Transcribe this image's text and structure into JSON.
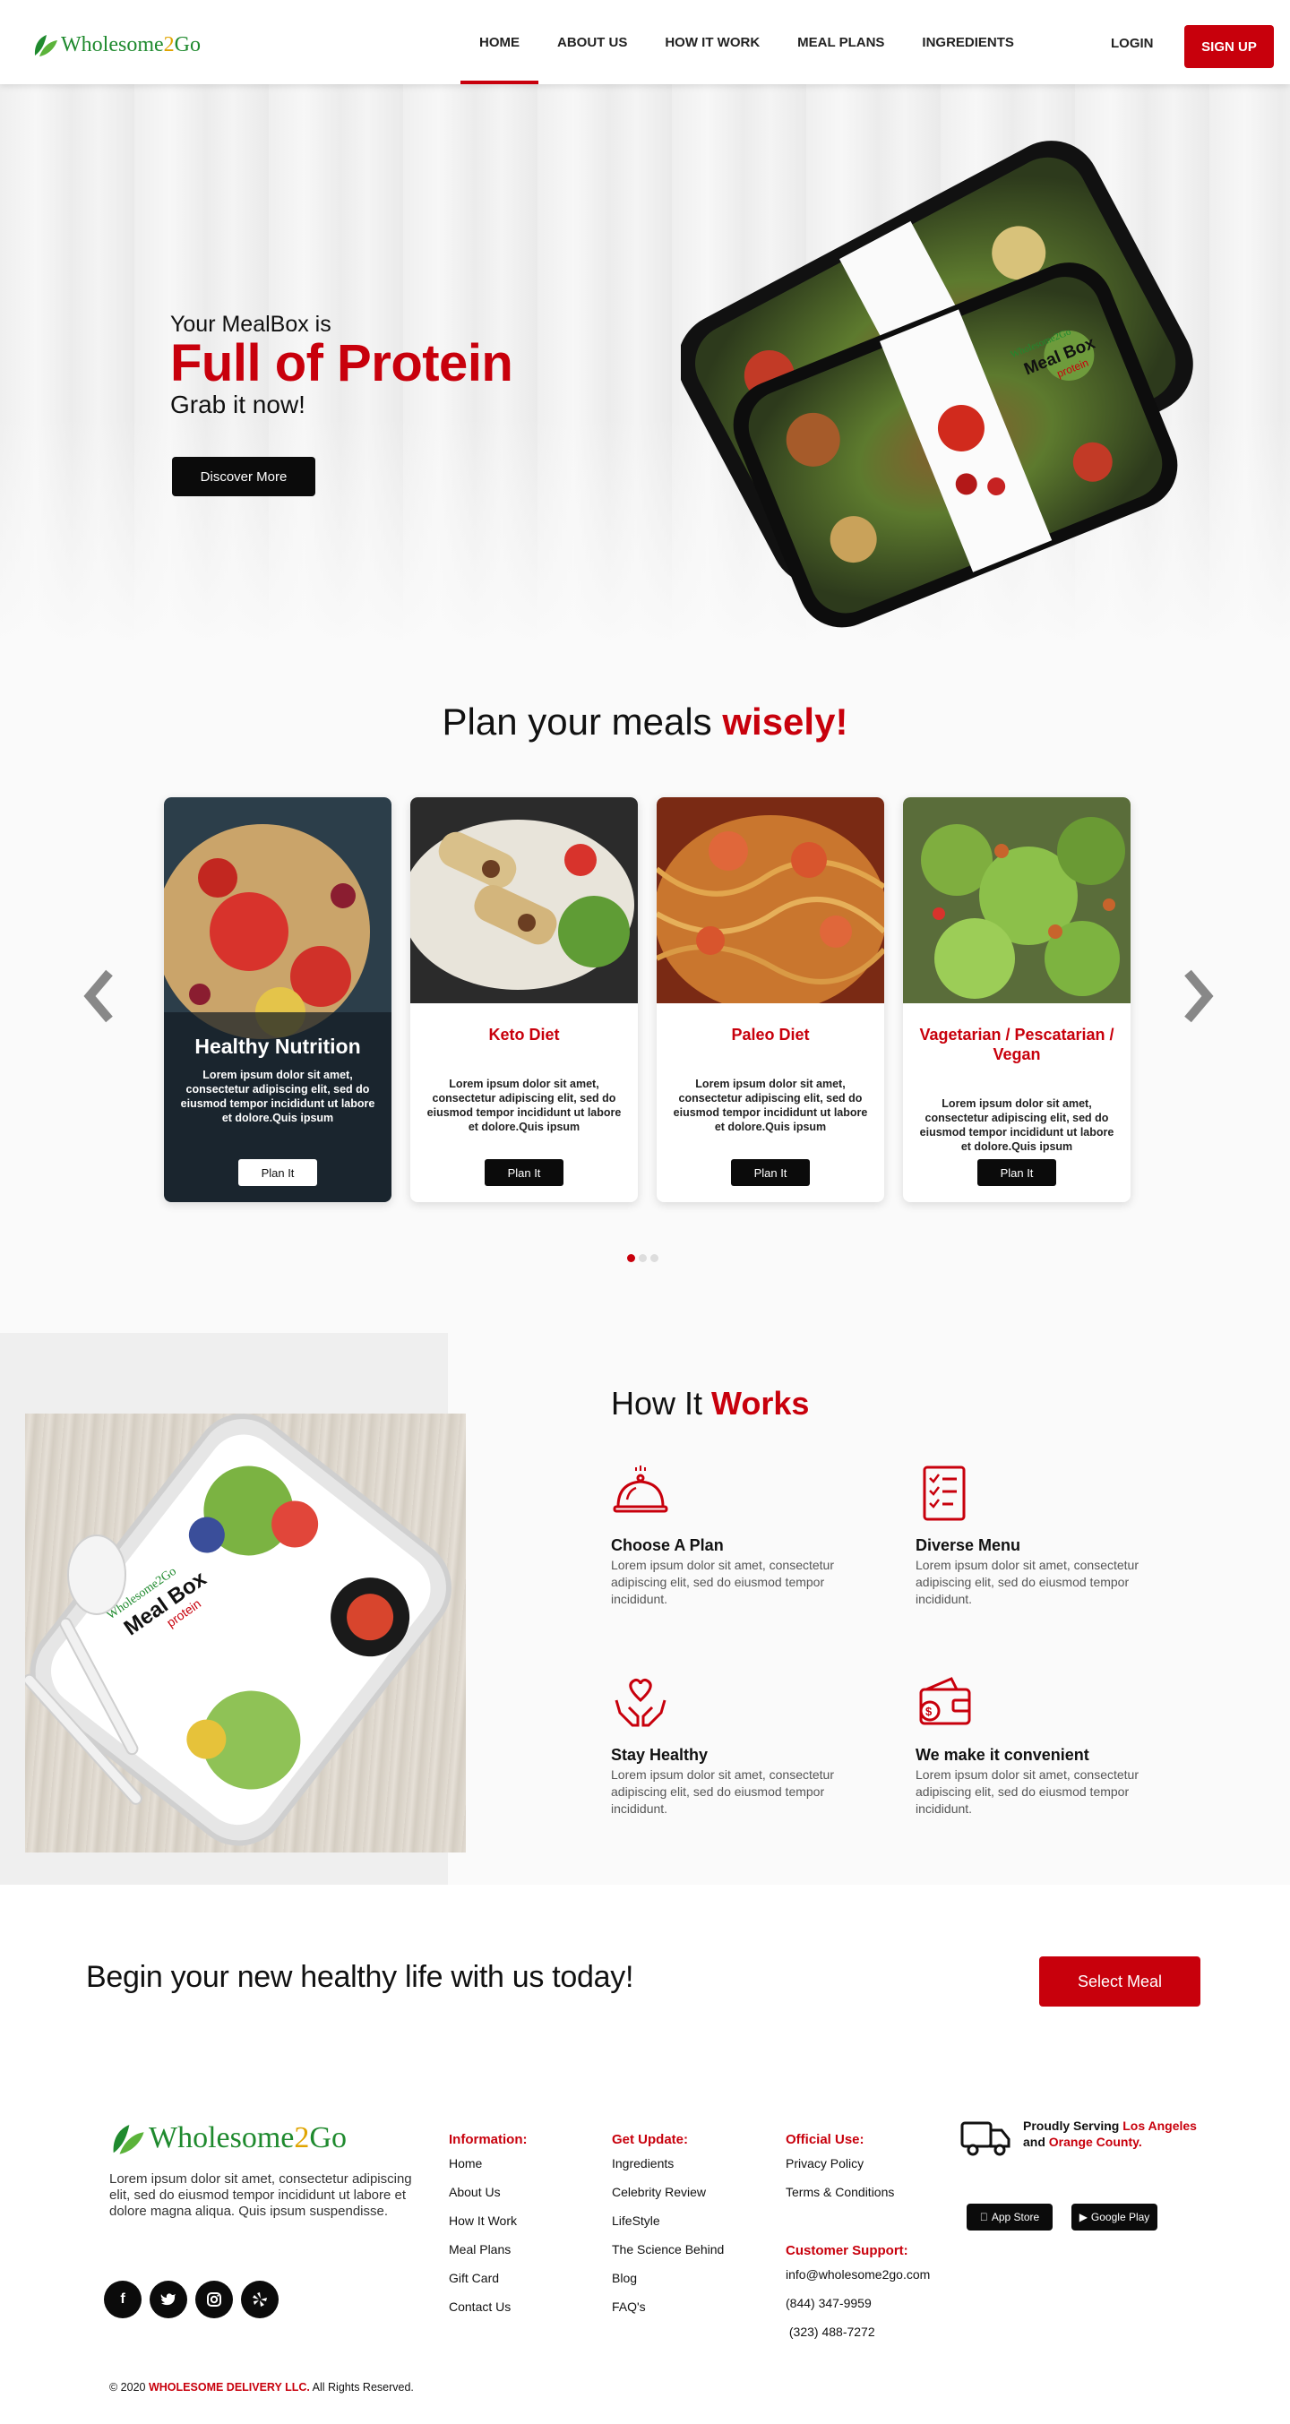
{
  "brand": {
    "name_part1": "Wholesome",
    "name_part2": "2",
    "name_part3": "Go"
  },
  "nav": {
    "links": [
      {
        "label": "HOME",
        "active": true
      },
      {
        "label": "ABOUT US",
        "active": false
      },
      {
        "label": "HOW IT WORK",
        "active": false
      },
      {
        "label": "MEAL PLANS",
        "active": false
      },
      {
        "label": "INGREDIENTS",
        "active": false
      }
    ],
    "login": "LOGIN",
    "signup": "SIGN UP"
  },
  "hero": {
    "subtitle": "Your MealBox is",
    "title": "Full of Protein",
    "tagline": "Grab it now!",
    "button": "Discover More",
    "box_label_brand": "Wholesome2Go",
    "box_label_title": "Meal Box",
    "box_label_sub": "protein"
  },
  "plans": {
    "title_plain": "Plan your meals",
    "title_accent": "wisely!",
    "cards": [
      {
        "title": "Healthy Nutrition",
        "desc": "Lorem ipsum dolor sit amet, consectetur adipiscing elit, sed do eiusmod tempor incididunt ut labore et dolore.Quis ipsum",
        "button": "Plan It"
      },
      {
        "title": "Keto Diet",
        "desc": "Lorem ipsum dolor sit amet, consectetur adipiscing elit, sed do eiusmod tempor incididunt ut labore et dolore.Quis ipsum",
        "button": "Plan It"
      },
      {
        "title": "Paleo Diet",
        "desc": "Lorem ipsum dolor sit amet, consectetur adipiscing elit, sed do eiusmod tempor incididunt ut labore et dolore.Quis ipsum",
        "button": "Plan It"
      },
      {
        "title": "Vagetarian / Pescatarian / Vegan",
        "desc": "Lorem ipsum dolor sit amet, consectetur adipiscing elit, sed do eiusmod tempor incididunt ut labore et dolore.Quis ipsum",
        "button": "Plan It"
      }
    ]
  },
  "how": {
    "title_plain": "How It",
    "title_accent": "Works",
    "features": [
      {
        "icon": "cloche-icon",
        "title": "Choose A Plan",
        "desc": "Lorem ipsum dolor sit amet, consectetur adipiscing elit, sed do eiusmod tempor incididunt."
      },
      {
        "icon": "menu-list-icon",
        "title": "Diverse Menu",
        "desc": "Lorem ipsum dolor sit amet, consectetur adipiscing elit, sed do eiusmod tempor incididunt."
      },
      {
        "icon": "heart-hands-icon",
        "title": "Stay Healthy",
        "desc": "Lorem ipsum dolor sit amet, consectetur adipiscing elit, sed do eiusmod tempor incididunt."
      },
      {
        "icon": "wallet-icon",
        "title": "We make it  convenient",
        "desc": "Lorem ipsum dolor sit amet, consectetur adipiscing elit, sed do eiusmod tempor incididunt."
      }
    ]
  },
  "cta": {
    "text": "Begin your  new healthy life with us today!",
    "button": "Select Meal"
  },
  "footer": {
    "about": "Lorem ipsum dolor sit amet, consectetur adipiscing elit, sed do eiusmod tempor incididunt ut labore et dolore magna aliqua. Quis ipsum suspendisse.",
    "socials": [
      "facebook-icon",
      "twitter-icon",
      "instagram-icon",
      "yelp-icon"
    ],
    "information": {
      "title": "Information:",
      "items": [
        "Home",
        "About Us",
        "How It Work",
        "Meal Plans",
        "Gift Card",
        "Contact Us"
      ]
    },
    "updates": {
      "title": "Get Update:",
      "items": [
        "Ingredients",
        "Celebrity Review",
        "LifeStyle",
        "The Science Behind",
        "Blog",
        "FAQ's"
      ]
    },
    "official": {
      "title": "Official Use:",
      "items": [
        "Privacy Policy",
        "Terms & Conditions"
      ]
    },
    "support": {
      "title": "Customer Support:",
      "items": [
        "info@wholesome2go.com",
        "(844) 347-9959",
        " (323) 488-7272"
      ]
    },
    "serving": {
      "prefix": "Proudly Serving",
      "city1": "Los Angeles",
      "and": "and",
      "city2": "Orange County."
    },
    "appstore": "App Store",
    "googleplay": "Google Play",
    "copyright": {
      "prefix": "© 2020",
      "company": "WHOLESOME DELIVERY LLC.",
      "suffix": "All Rights Reserved."
    }
  },
  "colors": {
    "accent": "#c8000c",
    "dark": "#0b0b0b",
    "green": "#1f8a2e"
  }
}
